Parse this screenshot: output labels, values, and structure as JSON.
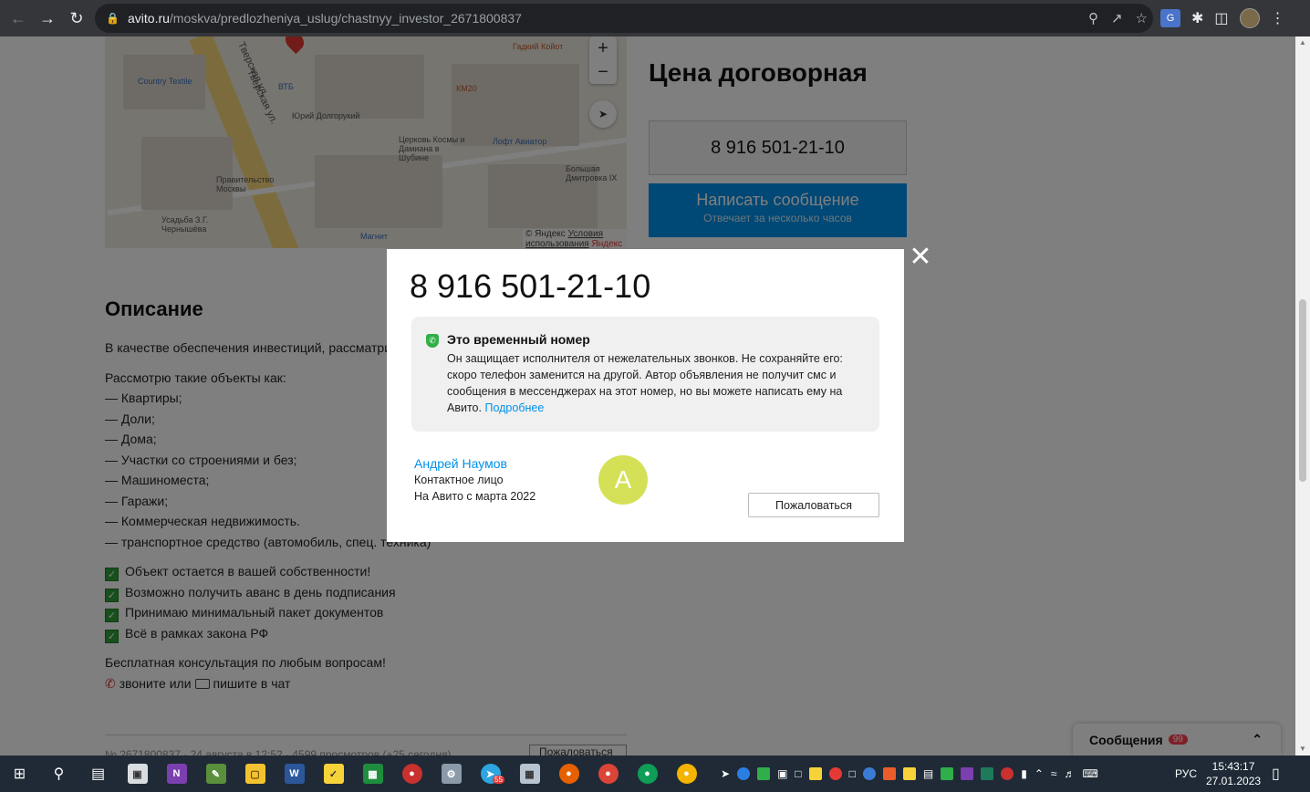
{
  "browser": {
    "url_host": "avito.ru",
    "url_path": "/moskva/predlozheniya_uslug/chastnyy_investor_2671800837"
  },
  "map": {
    "labels": [
      "Гадкий Койот",
      "Country Textile",
      "ВТБ",
      "Юрий Долгорукий",
      "Церковь Космы и Дамиана в Шубине",
      "Лофт Авиатор",
      "Правительство Москвы",
      "Усадьба З.Г. Чернышёва",
      "Магнит",
      "Большая Дмитровка IX",
      "КМ20",
      "Тверская ул.",
      "Тверская ул."
    ],
    "copyright": "© Яндекс",
    "terms": "Условия использования",
    "brand": "Яндекс"
  },
  "listing": {
    "price": "Цена договорная",
    "phone": "8 916 501-21-10",
    "message_btn": "Написать сообщение",
    "message_sub": "Отвечает за несколько часов",
    "desc_title": "Описание",
    "desc_intro": "В качестве обеспечения инвестиций, рассматриваю",
    "desc_objects_title": "Рассмотрю такие объекты как:",
    "desc_items": [
      "— Квартиры;",
      "— Доли;",
      "— Дома;",
      "— Участки со строениями и без;",
      "— Машиноместа;",
      "— Гаражи;",
      "— Коммерческая недвижимость.",
      "— транспортное средство (автомобиль, спец. техника)"
    ],
    "checks": [
      "Объект остается в вашей собственности!",
      "Возможно получить аванс в день подписания",
      "Принимаю минимальный пакет документов",
      "Всё в рамках закона РФ"
    ],
    "consult": "Бесплатная консультация по любым вопросам!",
    "call": "звоните или",
    "write": "пишите в чат",
    "footer": "№ 2671800837 · 24 августа в 12:52 · 4599 просмотров (+25 сегодня)",
    "footer_btn": "Пожаловаться"
  },
  "modal": {
    "phone": "8 916 501-21-10",
    "notice_title": "Это временный номер",
    "notice_body": "Он защищает исполнителя от нежелательных звонков. Не сохраняйте его: скоро телефон заменится на другой. Автор объявления не получит смс и сообщения в мессенджерах на этот номер, но вы можете написать ему на Авито.",
    "notice_link": "Подробнее",
    "seller_name": "Андрей Наумов",
    "seller_role": "Контактное лицо",
    "seller_since": "На Авито с марта 2022",
    "avatar_letter": "А",
    "report": "Пожаловаться"
  },
  "messages_widget": {
    "label": "Сообщения",
    "badge": "99"
  },
  "taskbar": {
    "telegram_badge": "55",
    "lang": "РУС",
    "time": "15:43:17",
    "date": "27.01.2023"
  },
  "colors": {
    "avito_blue": "#0091ea",
    "avatar": "#d4e157",
    "shield_green": "#2fae49"
  }
}
